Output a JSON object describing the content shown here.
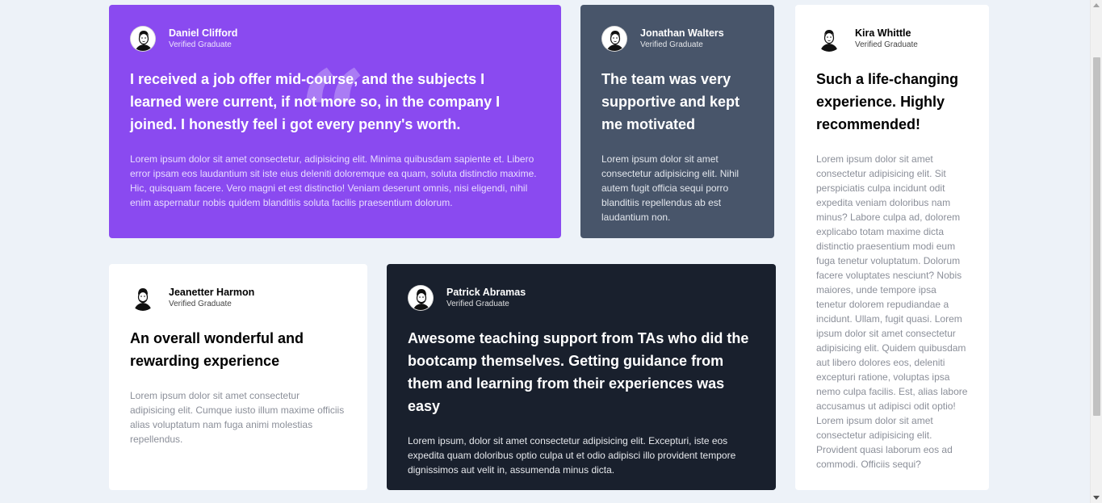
{
  "testimonials": [
    {
      "name": "Daniel Clifford",
      "role": "Verified Graduate",
      "headline": "I received a job offer mid-course, and the subjects I learned were current, if not more so, in the company I joined. I honestly feel i got every penny's worth.",
      "body": "Lorem ipsum dolor sit amet consectetur, adipisicing elit. Minima quibusdam sapiente et. Libero error ipsam eos laudantium sit iste eius deleniti doloremque ea quam, soluta distinctio maxime. Hic, quisquam facere. Vero magni et est distinctio! Veniam deserunt omnis, nisi eligendi, nihil enim aspernatur nobis quidem blanditiis soluta facilis praesentium dolorum.",
      "quote_glyph": "“"
    },
    {
      "name": "Jonathan Walters",
      "role": "Verified Graduate",
      "headline": "The team was very supportive and kept me motivated",
      "body": "Lorem ipsum dolor sit amet consectetur adipisicing elit. Nihil autem fugit officia sequi porro blanditiis repellendus ab est laudantium non."
    },
    {
      "name": "Kira Whittle",
      "role": "Verified Graduate",
      "headline": "Such a life-changing experience. Highly recommended!",
      "body": "Lorem ipsum dolor sit amet consectetur adipisicing elit. Sit perspiciatis culpa incidunt odit expedita veniam doloribus nam minus? Labore culpa ad, dolorem explicabo totam maxime dicta distinctio praesentium modi eum fuga tenetur voluptatum. Dolorum facere voluptates nesciunt? Nobis maiores, unde tempore ipsa tenetur dolorem repudiandae a incidunt. Ullam, fugit quasi. Lorem ipsum dolor sit amet consectetur adipisicing elit. Quidem quibusdam aut libero dolores eos, deleniti excepturi ratione, voluptas ipsa nemo culpa facilis. Est, alias labore accusamus ut adipisci odit optio! Lorem ipsum dolor sit amet consectetur adipisicing elit. Provident quasi laborum eos ad commodi. Officiis sequi?"
    },
    {
      "name": "Jeanetter Harmon",
      "role": "Verified Graduate",
      "headline": "An overall wonderful and rewarding experience",
      "body": "Lorem ipsum dolor sit amet consectetur adipisicing elit. Cumque iusto illum maxime officiis alias voluptatum nam fuga animi molestias repellendus."
    },
    {
      "name": "Patrick Abramas",
      "role": "Verified Graduate",
      "headline": "Awesome teaching support from TAs who did the bootcamp themselves. Getting guidance from them and learning from their experiences was easy",
      "body": "Lorem ipsum, dolor sit amet consectetur adipisicing elit. Excepturi, iste eos expedita quam doloribus optio culpa ut et odio adipisci illo provident tempore dignissimos aut velit in, assumenda minus dicta."
    }
  ],
  "colors": {
    "page_bg": "#edf2f8",
    "purple": "#8a4af0",
    "slate": "#48556a",
    "white": "#ffffff",
    "dark": "#19202d"
  },
  "icons": {
    "avatar": "person-avatar-icon",
    "quote": "quote-mark-icon"
  }
}
